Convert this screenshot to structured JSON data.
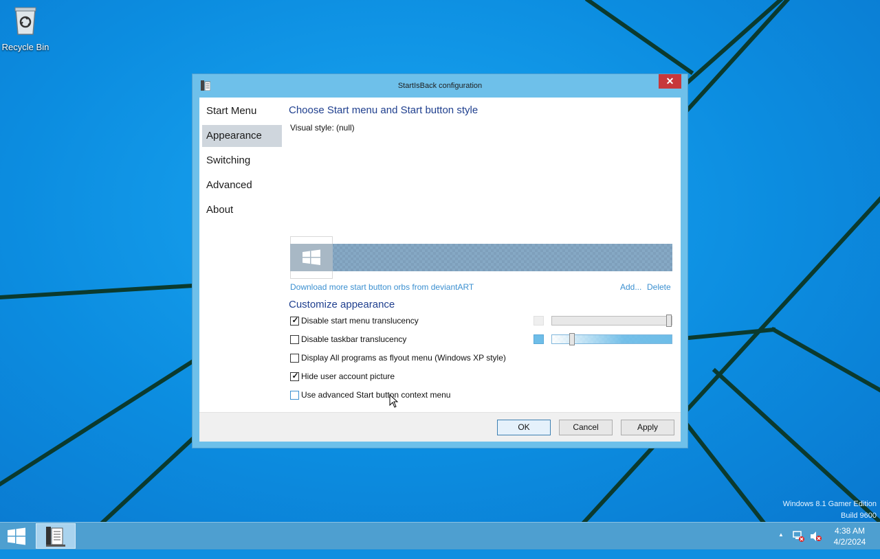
{
  "desktop": {
    "recycle_bin_label": "Recycle Bin",
    "watermark_line1": "Windows 8.1 Gamer Edition",
    "watermark_line2": "Build 9600"
  },
  "dialog": {
    "title": "StartIsBack configuration",
    "close_symbol": "✕",
    "nav": [
      {
        "label": "Start Menu"
      },
      {
        "label": "Appearance",
        "selected": true
      },
      {
        "label": "Switching"
      },
      {
        "label": "Advanced"
      },
      {
        "label": "About"
      }
    ],
    "style_heading": "Choose Start menu and Start button style",
    "visual_style_label": "Visual style:",
    "visual_style_value": "(null)",
    "download_link": "Download more start button orbs from deviantART",
    "add_link": "Add...",
    "delete_link": "Delete",
    "customize_heading": "Customize appearance",
    "options": [
      {
        "label": "Disable start menu translucency",
        "checked": true
      },
      {
        "label": "Disable taskbar translucency",
        "checked": false
      },
      {
        "label": "Display All programs as flyout menu (Windows XP style)",
        "checked": false
      },
      {
        "label": "Hide user account picture",
        "checked": true
      },
      {
        "label": "Use advanced Start button context menu",
        "checked": false
      }
    ],
    "sliders": {
      "start_menu_translucency": 1.0,
      "taskbar_translucency": 0.15
    },
    "buttons": {
      "ok": "OK",
      "cancel": "Cancel",
      "apply": "Apply"
    },
    "check_mark": "✓"
  },
  "taskbar": {
    "time": "4:38 AM",
    "date": "4/2/2024",
    "tray_arrow": "▲"
  },
  "colors": {
    "desktop_bg": "#0f8fe0",
    "window_frame": "#6ec0ea",
    "close_button": "#c7383b",
    "heading_text": "#1f3f8e",
    "link_text": "#3a8fd0",
    "taskbar": "#4e9fd0"
  }
}
